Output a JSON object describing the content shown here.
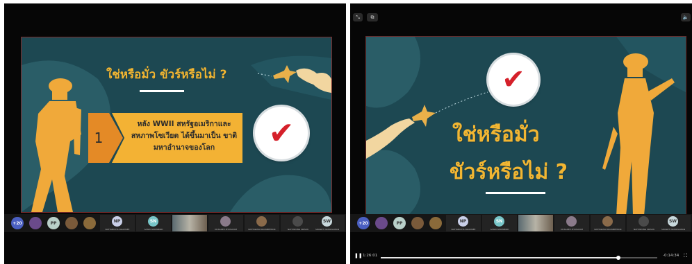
{
  "left": {
    "slide": {
      "title": "ใช่หรือมั่ว ขัวร์หรือไม่ ?",
      "question_number": "1",
      "question_text": "หลัง WWII สหรัฐอเมริกาและ สหภาพโซเวียต ได้ขึ้นมาเป็น ขาติมหาอำนาจของโลก",
      "check_mark": "✔"
    },
    "participants": [
      {
        "initials": "+20",
        "color": "#4a5fc1"
      },
      {
        "initials": "",
        "color": "#6a4a8a"
      },
      {
        "initials": "PP",
        "color": "#b9d0c9"
      },
      {
        "initials": "",
        "color": "#7a5a3a"
      },
      {
        "initials": "",
        "color": "#8a6a3a"
      }
    ],
    "tiles": [
      {
        "initials": "NP",
        "name": "NATTANICHA NGAMSEE",
        "color": "#c9cfe8"
      },
      {
        "initials": "SN",
        "name": "SASIN SNOWBIRD",
        "color": "#78c6c9"
      },
      {
        "initials": "",
        "name": "",
        "color": ""
      },
      {
        "initials": "",
        "name": "DUSADEE PHUSAYAM",
        "color": "#8a7a8a"
      },
      {
        "initials": "",
        "name": "NATTAWAN BOONMEENOK",
        "color": "#8a6a4a"
      },
      {
        "initials": "",
        "name": "NATTAPONG SRISUK",
        "color": "#4a4a4a"
      },
      {
        "initials": "SW",
        "name": "SIRAWIT WONGSAWAN",
        "color": "#c8d8dc"
      }
    ]
  },
  "right": {
    "slide": {
      "title_line1": "ใช่หรือมั่ว",
      "title_line2": "ขัวร์หรือไม่ ?",
      "check_mark": "✔"
    },
    "controls": {
      "expand_icon_label": "⤡",
      "pip_icon_label": "⧉",
      "volume_icon_label": "🔈"
    },
    "participants": [
      {
        "initials": "+20",
        "color": "#4a5fc1"
      },
      {
        "initials": "",
        "color": "#6a4a8a"
      },
      {
        "initials": "PP",
        "color": "#b9d0c9"
      },
      {
        "initials": "",
        "color": "#7a5a3a"
      },
      {
        "initials": "",
        "color": "#8a6a3a"
      }
    ],
    "tiles": [
      {
        "initials": "NP",
        "name": "NATTANICHA NGAMSEE",
        "color": "#c9cfe8"
      },
      {
        "initials": "SN",
        "name": "SASIN SNOWBIRD",
        "color": "#78c6c9"
      },
      {
        "initials": "",
        "name": "",
        "color": ""
      },
      {
        "initials": "",
        "name": "DUSADEE PHUSAYAM",
        "color": "#8a7a8a"
      },
      {
        "initials": "",
        "name": "NATTAWAN BOONMEENOK",
        "color": "#8a6a4a"
      },
      {
        "initials": "",
        "name": "NATTAPONG SRISUK",
        "color": "#4a4a4a"
      },
      {
        "initials": "SW",
        "name": "SIRAWIT WONGSAWAN",
        "color": "#c8d8dc"
      }
    ],
    "player": {
      "play_pause_label": "❚❚",
      "elapsed": "1:26:01",
      "remaining": "-0:14:34",
      "progress": 0.86,
      "fullscreen_label": "⛶"
    }
  }
}
